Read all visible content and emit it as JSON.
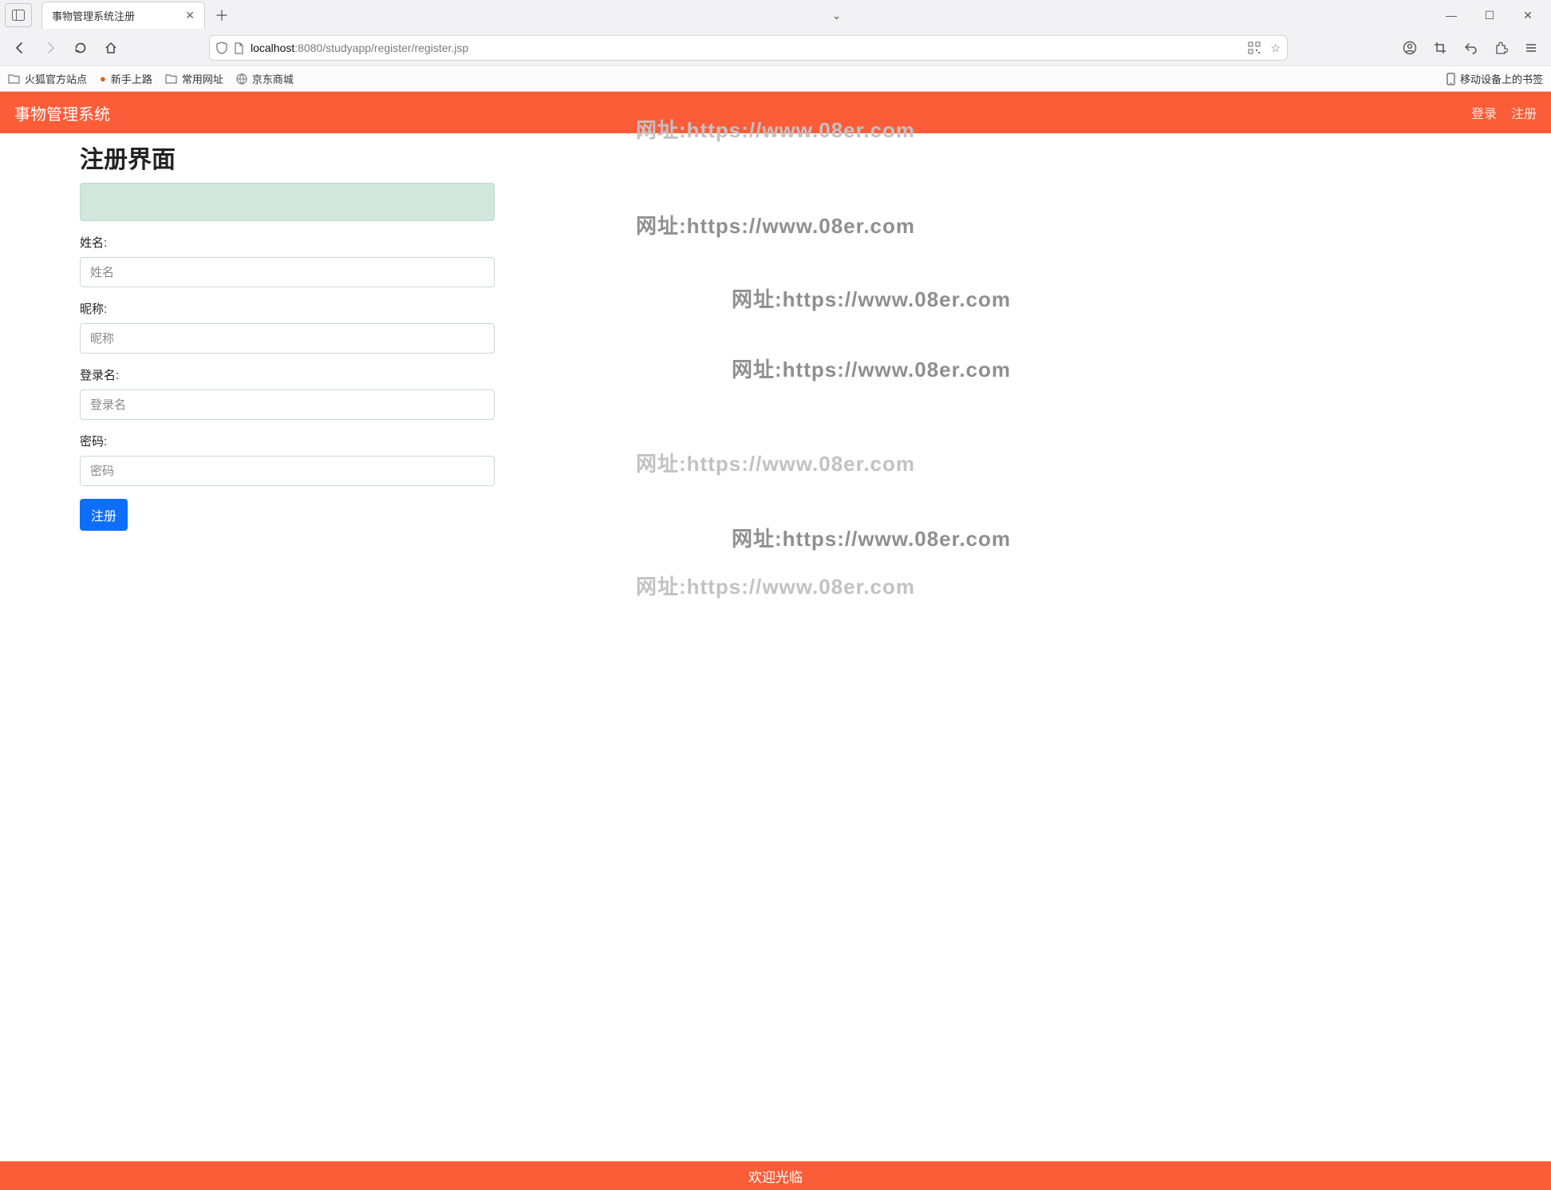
{
  "browser": {
    "tab_title": "事物管理系统注册",
    "url_host_weak_prefix": "localhost",
    "url_host_weak_suffix": ":8080",
    "url_path": "/studyapp/register/register.jsp",
    "bookmarks": {
      "b1": "火狐官方站点",
      "b2": "新手上路",
      "b3": "常用网址",
      "b4": "京东商城",
      "b_right": "移动设备上的书签"
    }
  },
  "site": {
    "brand": "事物管理系统",
    "nav_login": "登录",
    "nav_register": "注册",
    "footer": "欢迎光临"
  },
  "page": {
    "title": "注册界面"
  },
  "form": {
    "name_label": "姓名:",
    "name_placeholder": "姓名",
    "nick_label": "昵称:",
    "nick_placeholder": "昵称",
    "login_label": "登录名:",
    "login_placeholder": "登录名",
    "password_label": "密码:",
    "password_placeholder": "密码",
    "submit_label": "注册"
  },
  "watermark": {
    "label": "网址",
    "url": ":https://www.08er.com"
  }
}
